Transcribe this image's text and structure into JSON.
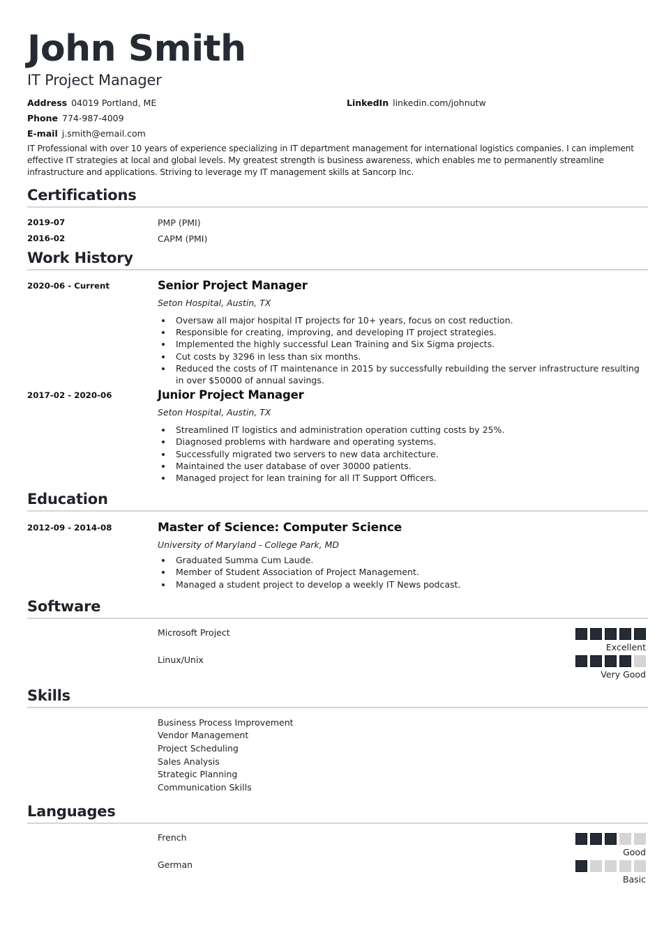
{
  "header": {
    "name": "John Smith",
    "title": "IT Project Manager"
  },
  "contacts": {
    "address": {
      "label": "Address",
      "value": "04019 Portland, ME"
    },
    "phone": {
      "label": "Phone",
      "value": "774-987-4009"
    },
    "email": {
      "label": "E-mail",
      "value": "j.smith@email.com"
    },
    "linkedin": {
      "label": "LinkedIn",
      "value": "linkedin.com/johnutw"
    }
  },
  "summary": "IT Professional with over 10 years of experience specializing in IT department management for international logistics companies. I can implement effective IT strategies at local and global levels. My greatest strength is business awareness, which enables me to permanently streamline infrastructure and applications. Striving to leverage my IT management skills at Sancorp Inc.",
  "certifications": {
    "heading": "Certifications",
    "items": [
      {
        "date": "2019-07",
        "name": "PMP (PMI)"
      },
      {
        "date": "2016-02",
        "name": "CAPM (PMI)"
      }
    ]
  },
  "work_history": {
    "heading": "Work History",
    "jobs": [
      {
        "date": "2020-06 - Current",
        "title": "Senior Project Manager",
        "company": "Seton Hospital, Austin, TX",
        "bullets": [
          "Oversaw all major hospital IT projects for 10+ years, focus on cost reduction.",
          "Responsible for creating, improving, and developing IT project strategies.",
          "Implemented the highly successful Lean Training and Six Sigma projects.",
          "Cut costs by 3296 in less than six months.",
          "Reduced the costs of IT maintenance in 2015 by successfully rebuilding the server infrastructure resulting in over $50000 of annual savings."
        ]
      },
      {
        "date": "2017-02 - 2020-06",
        "title": "Junior Project Manager",
        "company": "Seton Hospital, Austin, TX",
        "bullets": [
          "Streamlined IT logistics and administration operation cutting costs by 25%.",
          "Diagnosed problems with hardware and operating systems.",
          "Successfully migrated two servers to new data architecture.",
          "Maintained the user database of over 30000 patients.",
          "Managed project for lean training for all IT Support Officers."
        ]
      }
    ]
  },
  "education": {
    "heading": "Education",
    "items": [
      {
        "date": "2012-09 - 2014-08",
        "degree": "Master of Science: Computer Science",
        "school": "University of Maryland - College Park, MD",
        "bullets": [
          "Graduated Summa Cum Laude.",
          "Member of Student Association of Project Management.",
          "Managed a student project to develop a weekly IT News podcast."
        ]
      }
    ]
  },
  "software": {
    "heading": "Software",
    "items": [
      {
        "name": "Microsoft Project",
        "level": 5,
        "max": 5,
        "label": "Excellent"
      },
      {
        "name": "Linux/Unix",
        "level": 4,
        "max": 5,
        "label": "Very Good"
      }
    ]
  },
  "skills": {
    "heading": "Skills",
    "items": [
      "Business Process Improvement",
      "Vendor Management",
      "Project Scheduling",
      "Sales Analysis",
      "Strategic Planning",
      "Communication Skills"
    ]
  },
  "languages": {
    "heading": "Languages",
    "items": [
      {
        "name": "French",
        "level": 3,
        "max": 5,
        "label": "Good"
      },
      {
        "name": "German",
        "level": 1,
        "max": 5,
        "label": "Basic"
      }
    ]
  }
}
